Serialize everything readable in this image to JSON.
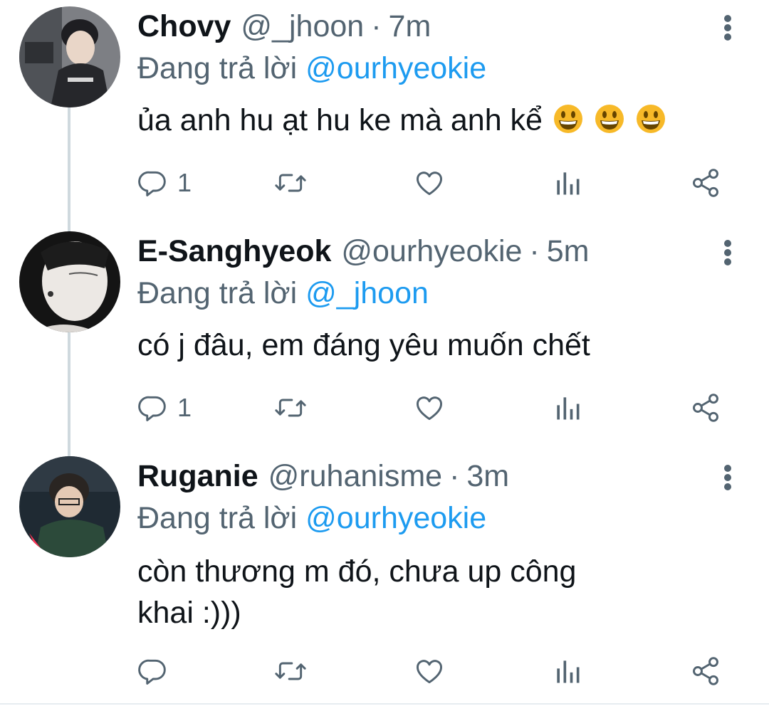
{
  "tweets": [
    {
      "display_name": "Chovy",
      "handle": "@_jhoon",
      "separator": "·",
      "time": "7m",
      "replying_prefix": "Đang trả lời",
      "replying_to": "@ourhyeokie",
      "text": "ủa anh hu ạt hu ke mà anh kể",
      "emojis": [
        "grinning-face-emoji",
        "grinning-face-emoji",
        "grinning-face-emoji"
      ],
      "reply_count": "1"
    },
    {
      "display_name": "E-Sanghyeok",
      "handle": "@ourhyeokie",
      "separator": "·",
      "time": "5m",
      "replying_prefix": "Đang trả lời",
      "replying_to": "@_jhoon",
      "text": "có j đâu, em đáng yêu muốn chết",
      "reply_count": "1"
    },
    {
      "display_name": "Ruganie",
      "handle": "@ruhanisme",
      "separator": "·",
      "time": "3m",
      "replying_prefix": "Đang trả lời",
      "replying_to": "@ourhyeokie",
      "text": "còn thương m đó, chưa up công khai :)))",
      "reply_count": ""
    }
  ],
  "icons": {
    "reply": "reply-icon",
    "retweet": "retweet-icon",
    "like": "heart-icon",
    "views": "views-chart-icon",
    "share": "share-icon",
    "more": "more-options-icon"
  },
  "colors": {
    "text_primary": "#0f1419",
    "text_secondary": "#536471",
    "link": "#1d9bf0",
    "thread_line": "#cfd9de",
    "emoji_face": "#f7b928"
  }
}
